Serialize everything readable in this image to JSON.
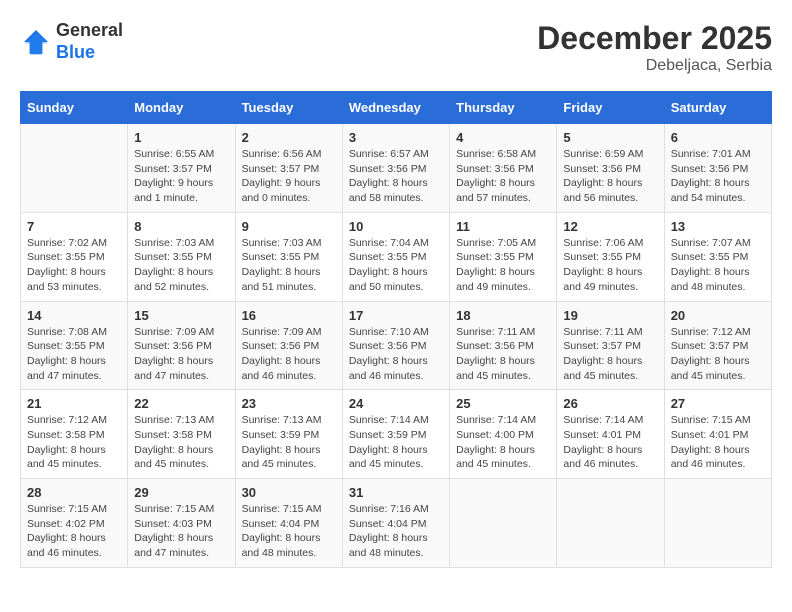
{
  "header": {
    "logo": {
      "line1": "General",
      "line2": "Blue"
    },
    "title": "December 2025",
    "location": "Debeljaca, Serbia"
  },
  "weekdays": [
    "Sunday",
    "Monday",
    "Tuesday",
    "Wednesday",
    "Thursday",
    "Friday",
    "Saturday"
  ],
  "weeks": [
    [
      {
        "day": "",
        "info": ""
      },
      {
        "day": "1",
        "info": "Sunrise: 6:55 AM\nSunset: 3:57 PM\nDaylight: 9 hours\nand 1 minute."
      },
      {
        "day": "2",
        "info": "Sunrise: 6:56 AM\nSunset: 3:57 PM\nDaylight: 9 hours\nand 0 minutes."
      },
      {
        "day": "3",
        "info": "Sunrise: 6:57 AM\nSunset: 3:56 PM\nDaylight: 8 hours\nand 58 minutes."
      },
      {
        "day": "4",
        "info": "Sunrise: 6:58 AM\nSunset: 3:56 PM\nDaylight: 8 hours\nand 57 minutes."
      },
      {
        "day": "5",
        "info": "Sunrise: 6:59 AM\nSunset: 3:56 PM\nDaylight: 8 hours\nand 56 minutes."
      },
      {
        "day": "6",
        "info": "Sunrise: 7:01 AM\nSunset: 3:56 PM\nDaylight: 8 hours\nand 54 minutes."
      }
    ],
    [
      {
        "day": "7",
        "info": "Sunrise: 7:02 AM\nSunset: 3:55 PM\nDaylight: 8 hours\nand 53 minutes."
      },
      {
        "day": "8",
        "info": "Sunrise: 7:03 AM\nSunset: 3:55 PM\nDaylight: 8 hours\nand 52 minutes."
      },
      {
        "day": "9",
        "info": "Sunrise: 7:03 AM\nSunset: 3:55 PM\nDaylight: 8 hours\nand 51 minutes."
      },
      {
        "day": "10",
        "info": "Sunrise: 7:04 AM\nSunset: 3:55 PM\nDaylight: 8 hours\nand 50 minutes."
      },
      {
        "day": "11",
        "info": "Sunrise: 7:05 AM\nSunset: 3:55 PM\nDaylight: 8 hours\nand 49 minutes."
      },
      {
        "day": "12",
        "info": "Sunrise: 7:06 AM\nSunset: 3:55 PM\nDaylight: 8 hours\nand 49 minutes."
      },
      {
        "day": "13",
        "info": "Sunrise: 7:07 AM\nSunset: 3:55 PM\nDaylight: 8 hours\nand 48 minutes."
      }
    ],
    [
      {
        "day": "14",
        "info": "Sunrise: 7:08 AM\nSunset: 3:55 PM\nDaylight: 8 hours\nand 47 minutes."
      },
      {
        "day": "15",
        "info": "Sunrise: 7:09 AM\nSunset: 3:56 PM\nDaylight: 8 hours\nand 47 minutes."
      },
      {
        "day": "16",
        "info": "Sunrise: 7:09 AM\nSunset: 3:56 PM\nDaylight: 8 hours\nand 46 minutes."
      },
      {
        "day": "17",
        "info": "Sunrise: 7:10 AM\nSunset: 3:56 PM\nDaylight: 8 hours\nand 46 minutes."
      },
      {
        "day": "18",
        "info": "Sunrise: 7:11 AM\nSunset: 3:56 PM\nDaylight: 8 hours\nand 45 minutes."
      },
      {
        "day": "19",
        "info": "Sunrise: 7:11 AM\nSunset: 3:57 PM\nDaylight: 8 hours\nand 45 minutes."
      },
      {
        "day": "20",
        "info": "Sunrise: 7:12 AM\nSunset: 3:57 PM\nDaylight: 8 hours\nand 45 minutes."
      }
    ],
    [
      {
        "day": "21",
        "info": "Sunrise: 7:12 AM\nSunset: 3:58 PM\nDaylight: 8 hours\nand 45 minutes."
      },
      {
        "day": "22",
        "info": "Sunrise: 7:13 AM\nSunset: 3:58 PM\nDaylight: 8 hours\nand 45 minutes."
      },
      {
        "day": "23",
        "info": "Sunrise: 7:13 AM\nSunset: 3:59 PM\nDaylight: 8 hours\nand 45 minutes."
      },
      {
        "day": "24",
        "info": "Sunrise: 7:14 AM\nSunset: 3:59 PM\nDaylight: 8 hours\nand 45 minutes."
      },
      {
        "day": "25",
        "info": "Sunrise: 7:14 AM\nSunset: 4:00 PM\nDaylight: 8 hours\nand 45 minutes."
      },
      {
        "day": "26",
        "info": "Sunrise: 7:14 AM\nSunset: 4:01 PM\nDaylight: 8 hours\nand 46 minutes."
      },
      {
        "day": "27",
        "info": "Sunrise: 7:15 AM\nSunset: 4:01 PM\nDaylight: 8 hours\nand 46 minutes."
      }
    ],
    [
      {
        "day": "28",
        "info": "Sunrise: 7:15 AM\nSunset: 4:02 PM\nDaylight: 8 hours\nand 46 minutes."
      },
      {
        "day": "29",
        "info": "Sunrise: 7:15 AM\nSunset: 4:03 PM\nDaylight: 8 hours\nand 47 minutes."
      },
      {
        "day": "30",
        "info": "Sunrise: 7:15 AM\nSunset: 4:04 PM\nDaylight: 8 hours\nand 48 minutes."
      },
      {
        "day": "31",
        "info": "Sunrise: 7:16 AM\nSunset: 4:04 PM\nDaylight: 8 hours\nand 48 minutes."
      },
      {
        "day": "",
        "info": ""
      },
      {
        "day": "",
        "info": ""
      },
      {
        "day": "",
        "info": ""
      }
    ]
  ]
}
